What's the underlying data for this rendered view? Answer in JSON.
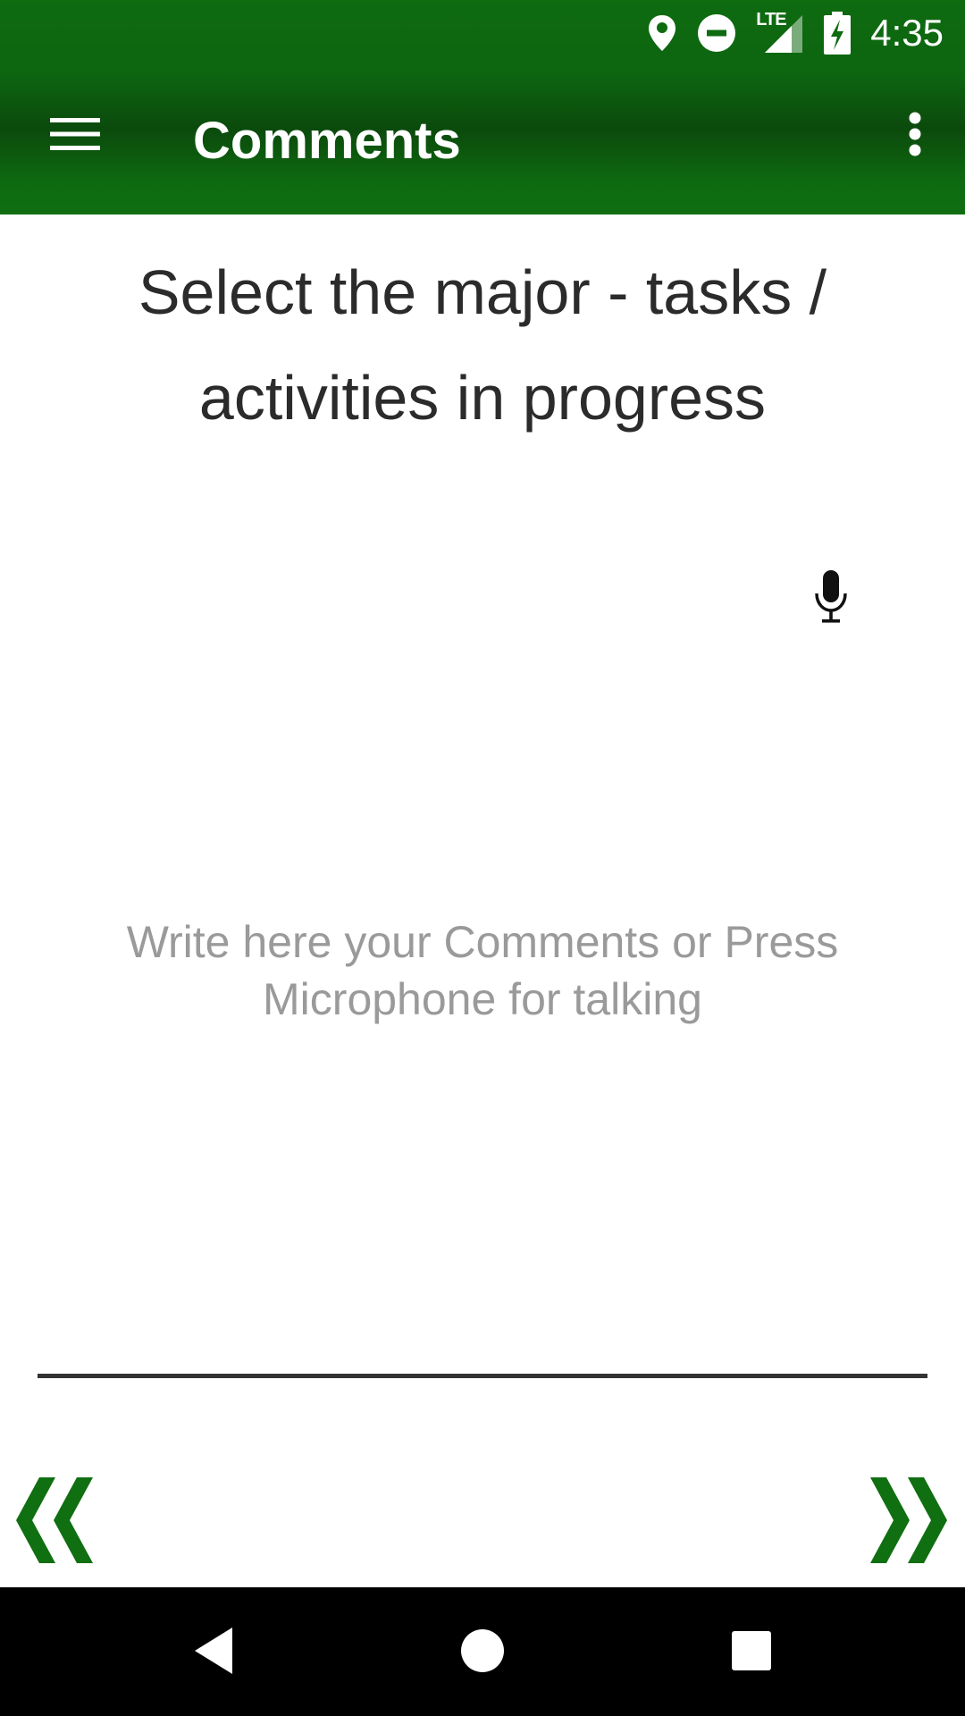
{
  "status_bar": {
    "time": "4:35",
    "network_label": "LTE",
    "icons": [
      "location-icon",
      "do-not-disturb-icon",
      "lte-signal-icon",
      "battery-charging-icon"
    ]
  },
  "app_bar": {
    "title": "Comments",
    "menu_icon": "hamburger-menu-icon",
    "overflow_icon": "more-vert-icon"
  },
  "main": {
    "question": "Select the major - tasks / activities in progress",
    "mic_icon": "microphone-icon",
    "comment_field": {
      "value": "",
      "placeholder": "Write here your Comments or Press Microphone for talking"
    }
  },
  "navigation": {
    "prev_icon": "double-chevron-left-icon",
    "next_icon": "double-chevron-right-icon"
  },
  "system_nav": {
    "back_icon": "back-triangle-icon",
    "home_icon": "home-circle-icon",
    "recent_icon": "recent-square-icon"
  },
  "colors": {
    "header_green": "#0e6b10",
    "arrow_green": "#0f6f11",
    "placeholder_gray": "#9a9a9a",
    "text_dark": "#2b2b2b"
  }
}
